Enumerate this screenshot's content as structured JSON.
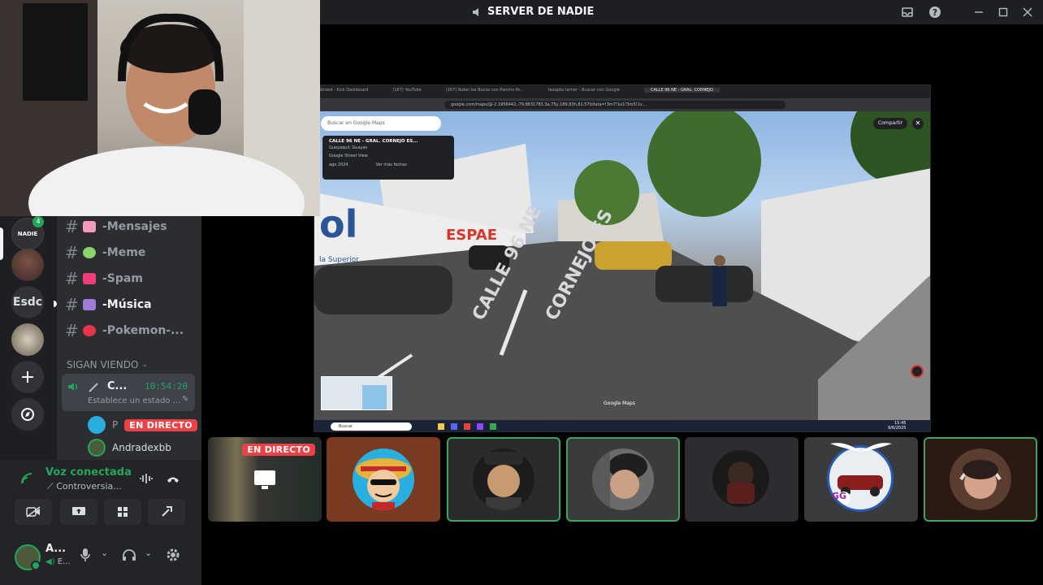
{
  "window": {
    "title": "SERVER DE NADIE",
    "icons": [
      "speaker-icon",
      "inbox-icon",
      "help-icon",
      "minimize-icon",
      "maximize-icon",
      "close-icon"
    ]
  },
  "servers": [
    {
      "name": "SERVER DE NADIE",
      "label": "NADIE",
      "badge": "4"
    },
    {
      "name": "avatar-server"
    },
    {
      "name": "text-server",
      "label": "Esdc"
    },
    {
      "name": "image-server"
    }
  ],
  "channels": [
    {
      "label": "-Mensajes",
      "active": false
    },
    {
      "label": "-Meme",
      "active": false
    },
    {
      "label": "-Spam",
      "active": false
    },
    {
      "label": "-Música",
      "active": true
    },
    {
      "label": "-Pokemon-...",
      "active": false
    }
  ],
  "voice_category": "SIGAN VIENDO",
  "voice_channel": {
    "user": "C...",
    "time": "10:54:20",
    "status": "Establece un estado ..."
  },
  "voice_users": [
    {
      "name": "P",
      "badge": "EN DIRECTO"
    },
    {
      "name": "Andradexbb"
    }
  ],
  "voice_panel": {
    "status": "Voz conectada",
    "channel": "Controversia...",
    "buttons": [
      "camera-off-icon",
      "screen-share-icon",
      "activities-icon",
      "soundboard-icon"
    ]
  },
  "user_panel": {
    "name": "A...",
    "status": "E..."
  },
  "stream": {
    "badge": "EN DIRECTO",
    "browser_tabs": [
      "Streed - Kick Dashboard",
      "(167) YouTube",
      "(167) Rubel los Bucos con Pancho Rr...",
      "taxapta tarrier - Buscar con Google",
      "CALLE 96 NE - GRAL. CORNEJO"
    ],
    "url": "google.com/maps/@-2.1956442,-79.8831783,3a,75y,189.83h,81.57t/data=!3m7!1e1!3m5!1s...",
    "maps_search_placeholder": "Buscar en Google Maps",
    "place_title": "CALLE 96 NE - GRAL. CORNEJO ES...",
    "place_subtitle": "Guayaquil, Guayas",
    "place_source": "Google Street View",
    "place_date": "ago 2024",
    "place_more": "Ver más fechas",
    "share_button": "Compartir",
    "street_sign_1": "CALLE 96 NE",
    "street_sign_2": "CORNEJO ES",
    "wall_text": "ESPAE",
    "wall_text_2": "ol",
    "wall_text_3": "la Superior",
    "watermark": "Google Maps",
    "taskbar_search": "Buscar",
    "taskbar_time": "15:45",
    "taskbar_date": "9/6/2025"
  },
  "tiles": [
    {
      "name": "stream-tile",
      "badge": "EN DIRECTO",
      "speaking": false
    },
    {
      "name": "luffy-avatar",
      "speaking": false
    },
    {
      "name": "user-avatar-cap",
      "speaking": true
    },
    {
      "name": "user-avatar-beanie",
      "speaking": true
    },
    {
      "name": "user-avatar-dark",
      "speaking": false
    },
    {
      "name": "user-avatar-gg",
      "label": "GG",
      "speaking": false
    },
    {
      "name": "user-avatar-headphones",
      "speaking": true
    }
  ],
  "colors": {
    "live": "#ed4245",
    "speaking": "#3ba55d",
    "sidebar": "#2b2d31",
    "serverbar": "#1e1f22",
    "tile_orange": "#7a3a1f",
    "tile_dark_orange": "#2a1a13"
  }
}
